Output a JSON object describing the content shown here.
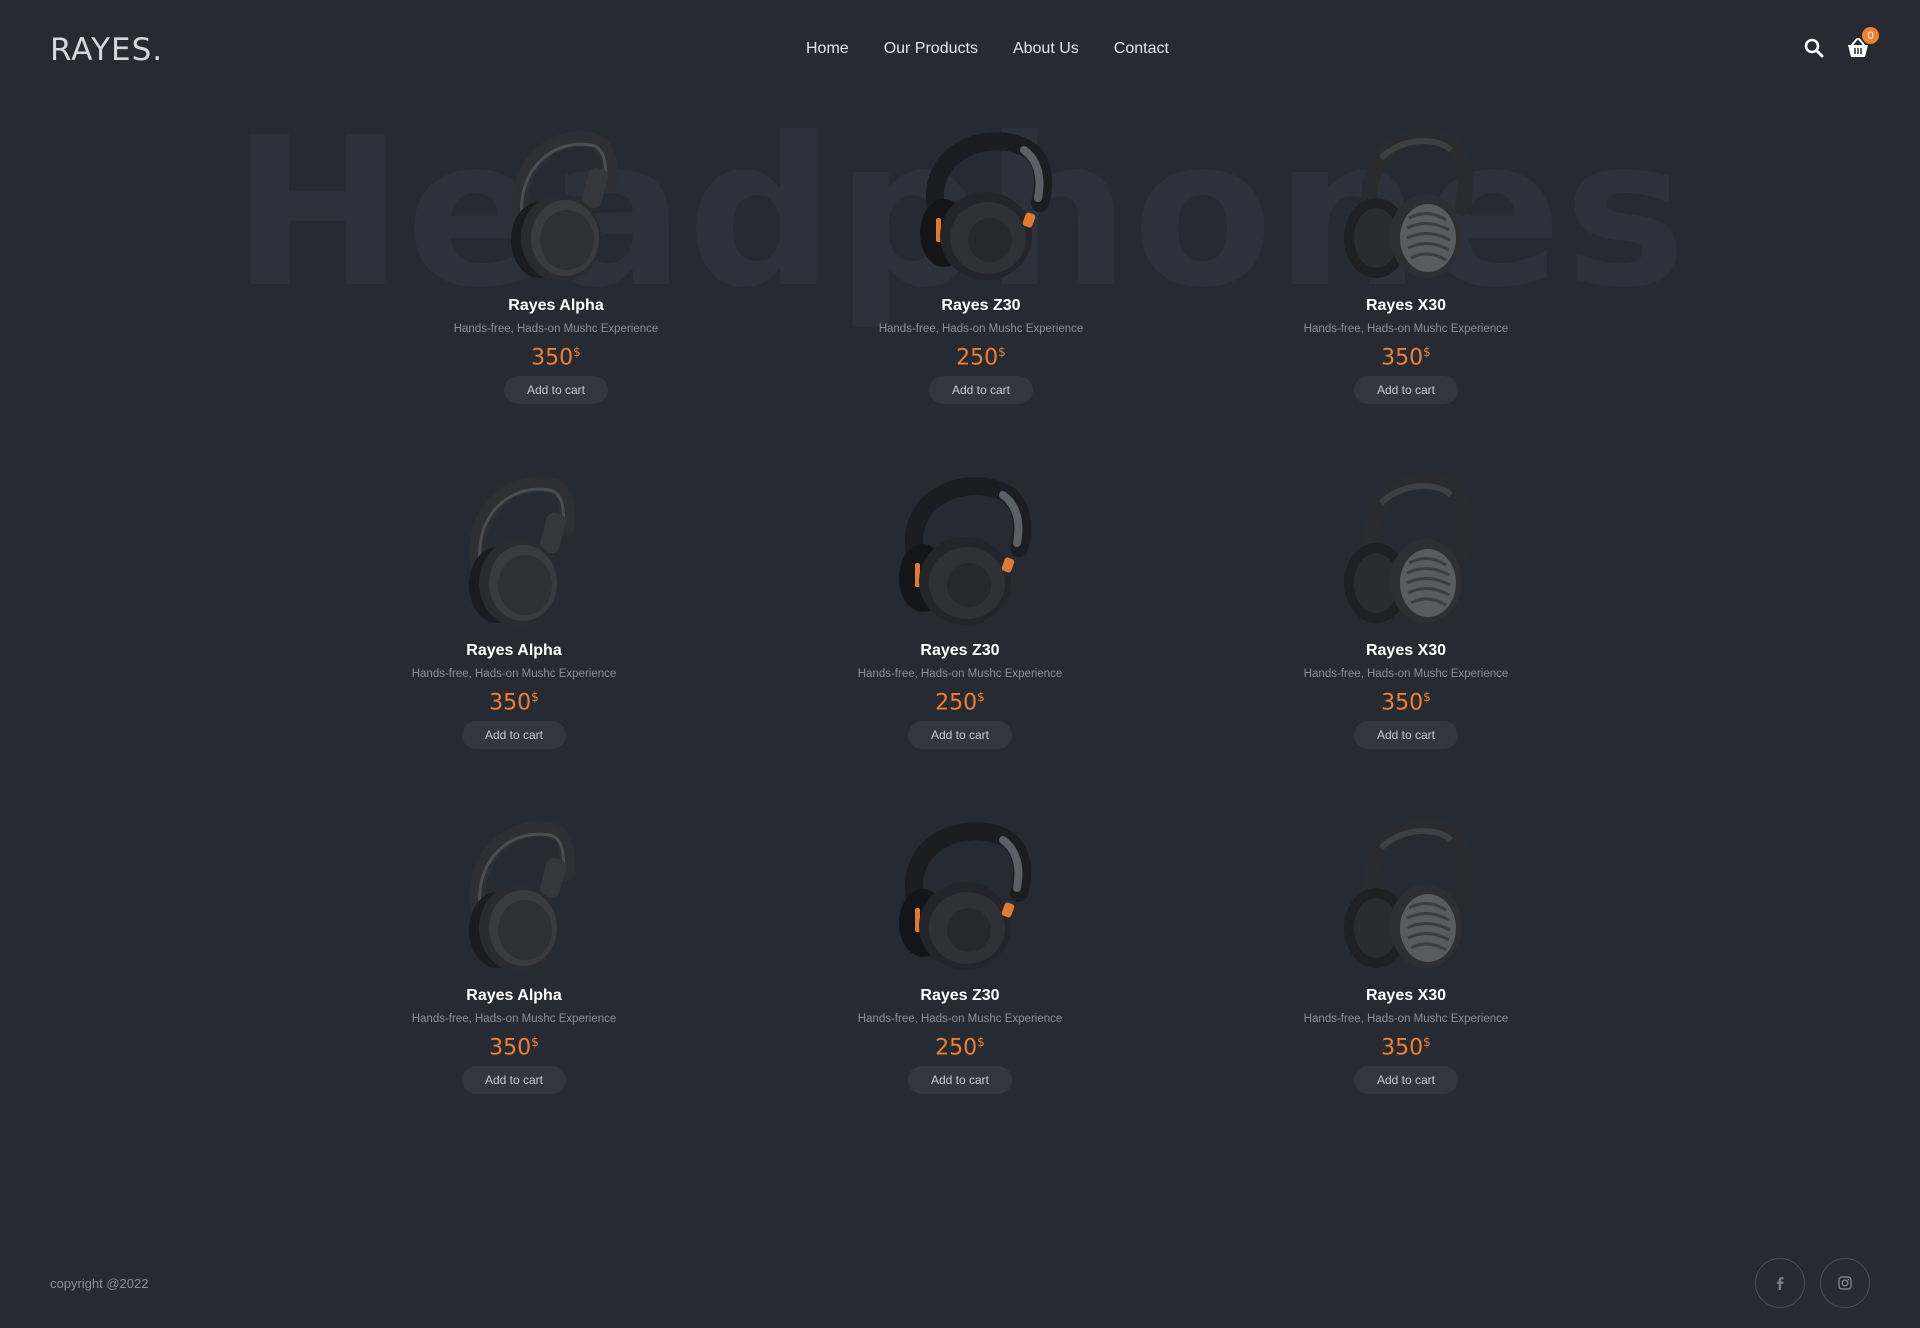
{
  "header": {
    "logo": "RAYES.",
    "nav": [
      "Home",
      "Our Products",
      "About Us",
      "Contact"
    ],
    "search_icon": "search-icon",
    "cart_icon": "basket-icon",
    "cart_count": "0"
  },
  "hero": {
    "watermark": "Headphones"
  },
  "products": [
    {
      "name": "Rayes Alpha",
      "desc": "Hands-free, Hads-on Mushc Experience",
      "price": "350",
      "currency": "$",
      "button": "Add to cart",
      "image": "headphone-alpha"
    },
    {
      "name": "Rayes Z30",
      "desc": "Hands-free, Hads-on Mushc Experience",
      "price": "250",
      "currency": "$",
      "button": "Add to cart",
      "image": "headphone-z30"
    },
    {
      "name": "Rayes X30",
      "desc": "Hands-free, Hads-on Mushc Experience",
      "price": "350",
      "currency": "$",
      "button": "Add to cart",
      "image": "headphone-x30"
    },
    {
      "name": "Rayes Alpha",
      "desc": "Hands-free, Hads-on Mushc Experience",
      "price": "350",
      "currency": "$",
      "button": "Add to cart",
      "image": "headphone-alpha"
    },
    {
      "name": "Rayes Z30",
      "desc": "Hands-free, Hads-on Mushc Experience",
      "price": "250",
      "currency": "$",
      "button": "Add to cart",
      "image": "headphone-z30"
    },
    {
      "name": "Rayes X30",
      "desc": "Hands-free, Hads-on Mushc Experience",
      "price": "350",
      "currency": "$",
      "button": "Add to cart",
      "image": "headphone-x30"
    },
    {
      "name": "Rayes Alpha",
      "desc": "Hands-free, Hads-on Mushc Experience",
      "price": "350",
      "currency": "$",
      "button": "Add to cart",
      "image": "headphone-alpha"
    },
    {
      "name": "Rayes Z30",
      "desc": "Hands-free, Hads-on Mushc Experience",
      "price": "250",
      "currency": "$",
      "button": "Add to cart",
      "image": "headphone-z30"
    },
    {
      "name": "Rayes X30",
      "desc": "Hands-free, Hads-on Mushc Experience",
      "price": "350",
      "currency": "$",
      "button": "Add to cart",
      "image": "headphone-x30"
    }
  ],
  "footer": {
    "copyright": "copyright @2022",
    "social": [
      "facebook-icon",
      "instagram-icon"
    ]
  },
  "colors": {
    "background": "#262a33",
    "accent": "#f07f2e",
    "button_bg": "#31363f"
  }
}
